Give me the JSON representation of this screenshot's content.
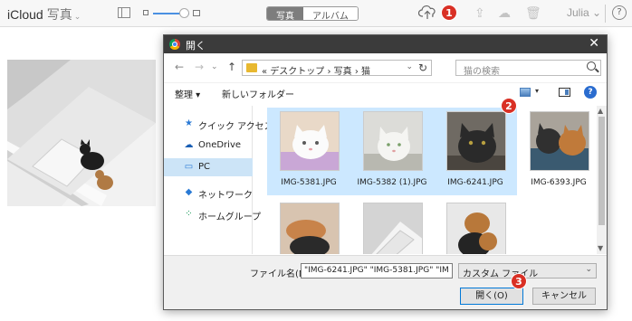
{
  "icloud": {
    "brand": "iCloud",
    "app_name": "写真",
    "segments": [
      "写真",
      "アルバム"
    ],
    "user": "Julia",
    "help": "?"
  },
  "badges": [
    "1",
    "2",
    "3"
  ],
  "dialog": {
    "title": "開く",
    "breadcrumb": [
      "デスクトップ",
      "写真",
      "猫"
    ],
    "search_placeholder": "猫の検索",
    "organize": "整理 ▾",
    "new_folder": "新しいフォルダー",
    "nav_items": [
      {
        "label": "クイック アクセス",
        "icon": "star-icon"
      },
      {
        "label": "OneDrive",
        "icon": "cloud-icon"
      },
      {
        "label": "PC",
        "icon": "computer-icon"
      },
      {
        "label": "ネットワーク",
        "icon": "network-icon"
      },
      {
        "label": "ホームグループ",
        "icon": "homegroup-icon"
      }
    ],
    "files": [
      {
        "name": "IMG-5381.JPG",
        "selected": true
      },
      {
        "name": "IMG-5382 (1).JPG",
        "selected": true
      },
      {
        "name": "IMG-6241.JPG",
        "selected": true
      },
      {
        "name": "IMG-6393.JPG",
        "selected": false
      },
      {
        "name": "",
        "selected": false
      },
      {
        "name": "",
        "selected": false
      },
      {
        "name": "",
        "selected": false
      }
    ],
    "filename_label": "ファイル名(N):",
    "filename_value": "\"IMG-6241.JPG\" \"IMG-5381.JPG\" \"IM",
    "filetype": "カスタム ファイル",
    "open_button": "開く(O)",
    "cancel_button": "キャンセル"
  },
  "colors": {
    "badge": "#d93025",
    "selection": "#cce8ff",
    "titlebar": "#3b3b3b"
  }
}
